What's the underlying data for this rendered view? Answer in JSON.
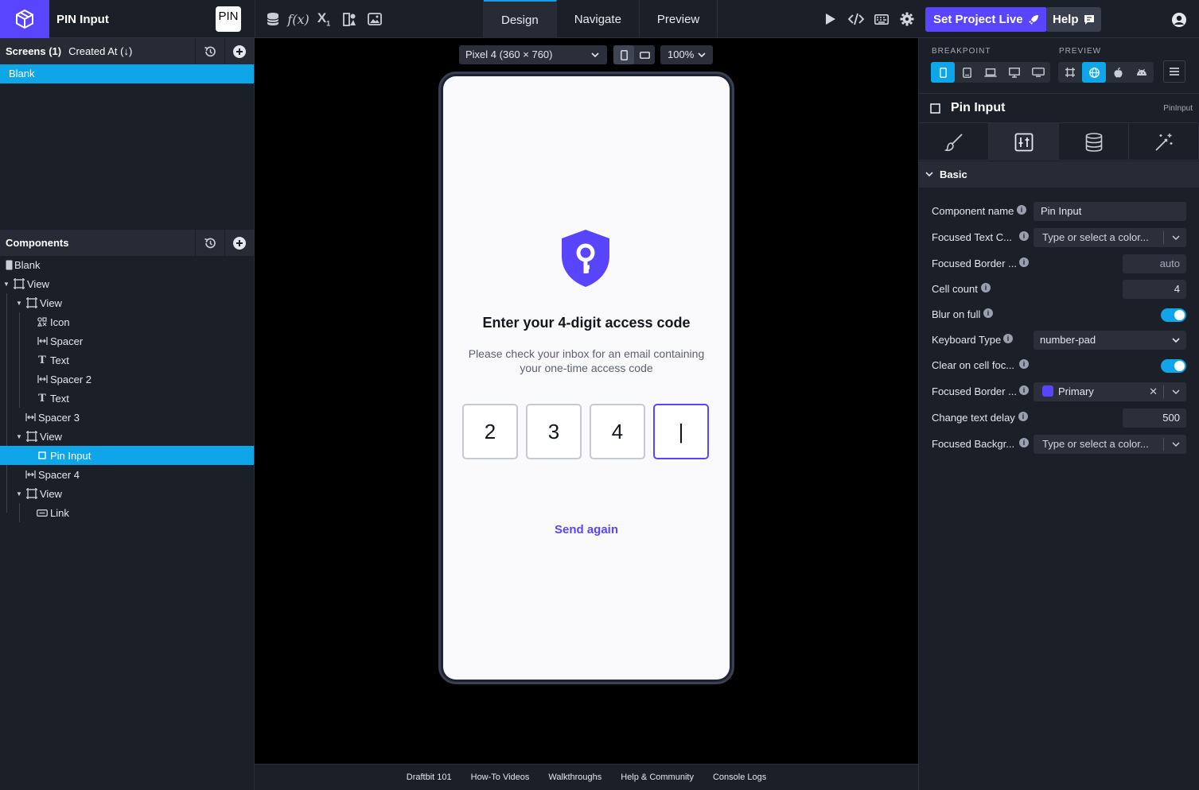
{
  "project": {
    "title": "PIN Input",
    "thumb_text": "PIN"
  },
  "modes": [
    {
      "label": "Design",
      "active": true
    },
    {
      "label": "Navigate",
      "active": false
    },
    {
      "label": "Preview",
      "active": false
    }
  ],
  "topbar": {
    "set_live_label": "Set Project Live",
    "help_label": "Help"
  },
  "screens": {
    "header_title": "Screens (1)",
    "header_sort": "Created At (↓)",
    "items": [
      "Blank"
    ]
  },
  "components": {
    "header_title": "Components",
    "tree": [
      {
        "label": "Blank",
        "icon": "screen-icon",
        "depth": 0,
        "caret": false
      },
      {
        "label": "View",
        "icon": "view-icon",
        "depth": 0,
        "caret": true
      },
      {
        "label": "View",
        "icon": "view-icon",
        "depth": 1,
        "caret": true
      },
      {
        "label": "Icon",
        "icon": "icon-component-icon",
        "depth": 2,
        "caret": false
      },
      {
        "label": "Spacer",
        "icon": "spacer-icon",
        "depth": 2,
        "caret": false
      },
      {
        "label": "Text",
        "icon": "text-icon",
        "depth": 2,
        "caret": false
      },
      {
        "label": "Spacer 2",
        "icon": "spacer-icon",
        "depth": 2,
        "caret": false
      },
      {
        "label": "Text",
        "icon": "text-icon",
        "depth": 2,
        "caret": false
      },
      {
        "label": "Spacer 3",
        "icon": "spacer-icon",
        "depth": 1,
        "caret": false
      },
      {
        "label": "View",
        "icon": "view-icon",
        "depth": 1,
        "caret": true
      },
      {
        "label": "Pin Input",
        "icon": "pin-input-icon",
        "depth": 2,
        "caret": false,
        "selected": true
      },
      {
        "label": "Spacer 4",
        "icon": "spacer-icon",
        "depth": 1,
        "caret": false
      },
      {
        "label": "View",
        "icon": "view-icon",
        "depth": 1,
        "caret": true
      },
      {
        "label": "Link",
        "icon": "link-icon",
        "depth": 2,
        "caret": false
      }
    ]
  },
  "canvas": {
    "device_label": "Pixel 4 (360 × 760)",
    "zoom_label": "100%",
    "heading": "Enter your 4-digit access code",
    "subtext": "Please check your inbox for an email containing your one-time access code",
    "pin_cells": [
      "2",
      "3",
      "4",
      "|"
    ],
    "send_again": "Send again",
    "accent": "#5a45ff"
  },
  "footer": [
    "Draftbit 101",
    "How-To Videos",
    "Walkthroughs",
    "Help & Community",
    "Console Logs"
  ],
  "inspector": {
    "breakpoint_label": "BREAKPOINT",
    "preview_label": "PREVIEW",
    "component_title": "Pin Input",
    "component_type": "PinInput",
    "section": "Basic",
    "props": {
      "component_name": {
        "label": "Component name",
        "value": "Pin Input"
      },
      "focused_text_color": {
        "label": "Focused Text C...",
        "placeholder": "Type or select a color..."
      },
      "focused_border_width": {
        "label": "Focused Border ...",
        "value": "auto"
      },
      "cell_count": {
        "label": "Cell count",
        "value": "4"
      },
      "blur_on_full": {
        "label": "Blur on full",
        "on": true
      },
      "keyboard_type": {
        "label": "Keyboard Type",
        "value": "number-pad"
      },
      "clear_on_cell_focus": {
        "label": "Clear on cell foc...",
        "on": true
      },
      "focused_border_color": {
        "label": "Focused Border ...",
        "value": "Primary"
      },
      "change_text_delay": {
        "label": "Change text delay",
        "value": "500"
      },
      "focused_background": {
        "label": "Focused Backgr...",
        "placeholder": "Type or select a color..."
      }
    }
  }
}
